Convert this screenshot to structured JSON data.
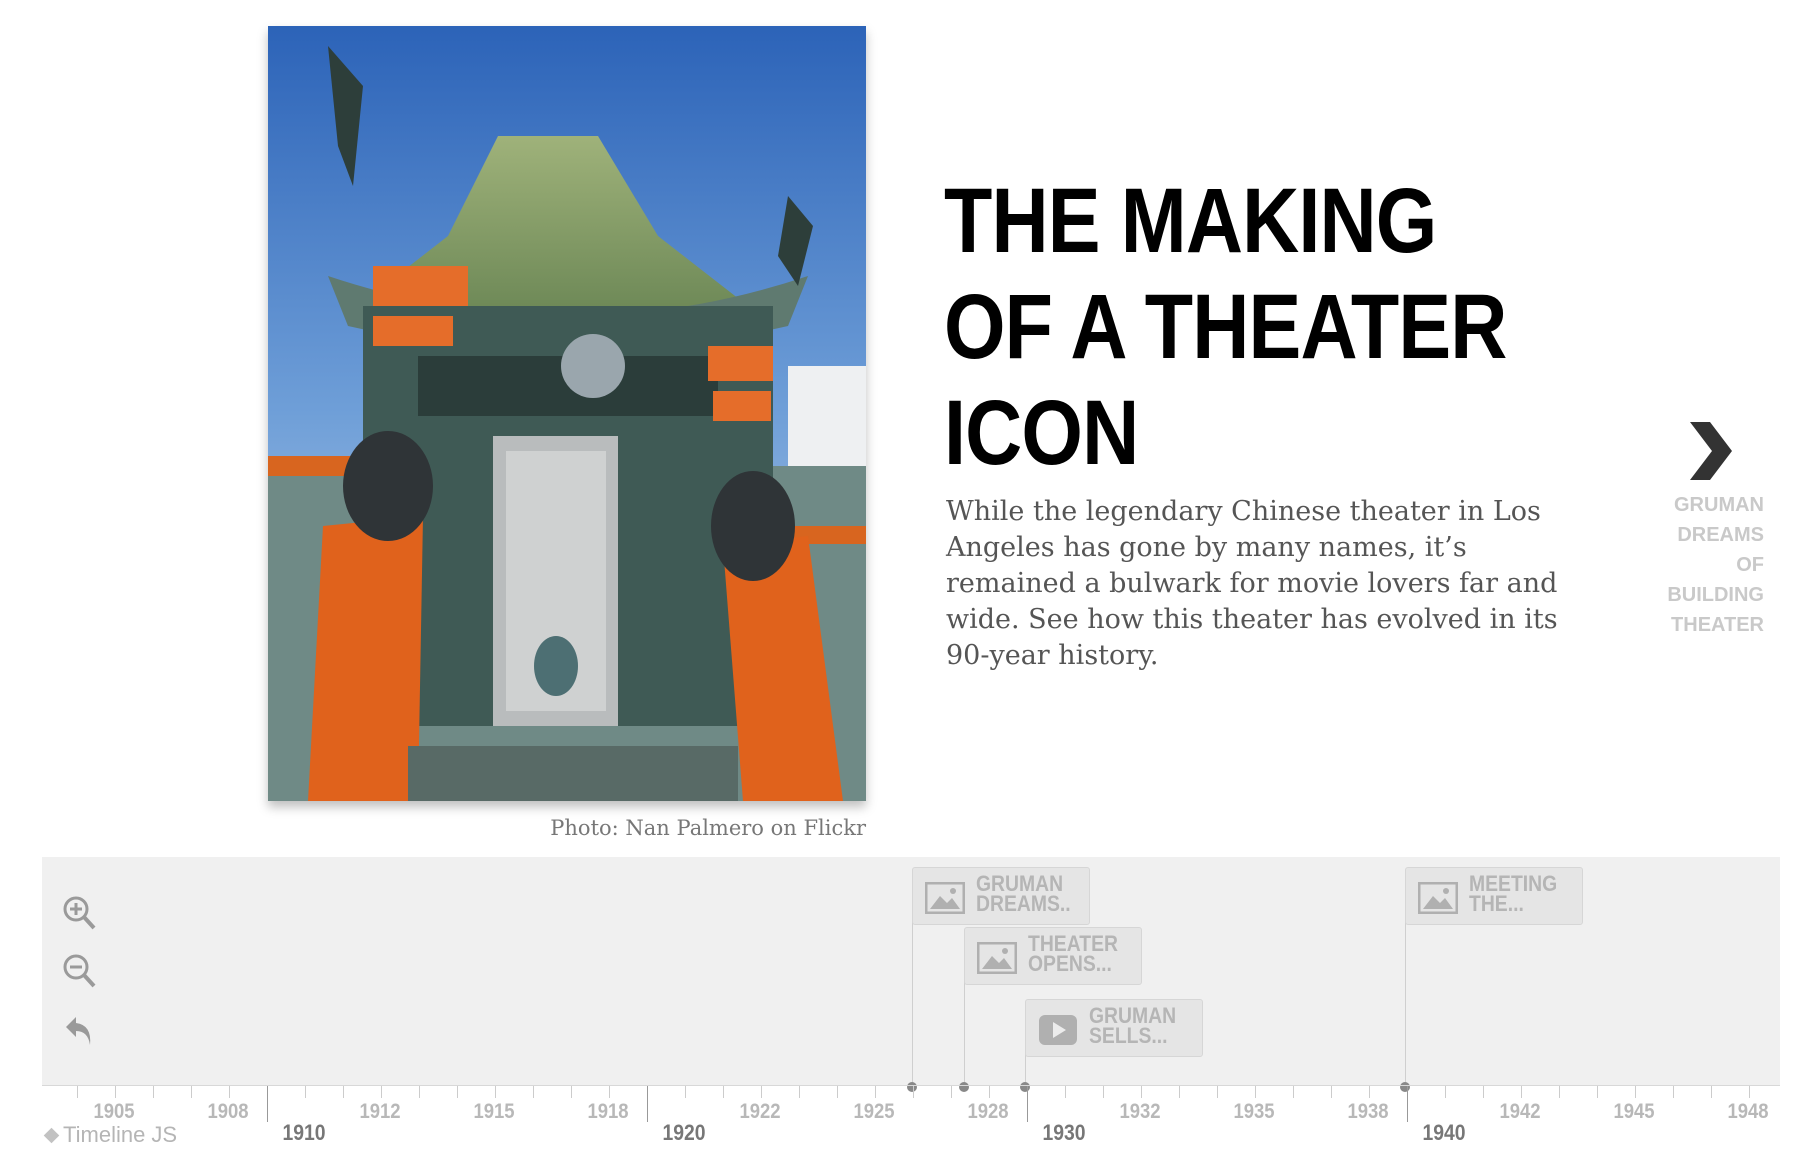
{
  "slide": {
    "headline": "THE MAKING OF A THEATER ICON",
    "text": "While the legendary Chinese theater in Los Angeles has gone by many names, it’s remained a bulwark for movie lovers far and wide. See how this theater has evolved in its 90-year history.",
    "credit": "Photo: Nan Palmero on Flickr",
    "image_subject": "Chinese theater facade with pagoda roof and orange columns"
  },
  "next": {
    "icon": "chevron-right-icon",
    "label": "GRUMAN DREAMS OF BUILDING THEATER"
  },
  "controls": {
    "zoom_in_icon": "zoom-in-icon",
    "zoom_out_icon": "zoom-out-icon",
    "back_icon": "undo-icon"
  },
  "markers": [
    {
      "title": "GRUMAN DREAMS...",
      "media": "image-icon"
    },
    {
      "title": "THEATER OPENS...",
      "media": "image-icon"
    },
    {
      "title": "GRUMAN SELLS...",
      "media": "video-icon"
    },
    {
      "title": "MEETING THE...",
      "media": "image-icon"
    }
  ],
  "axis": {
    "minor": [
      "1905",
      "1908",
      "1912",
      "1915",
      "1918",
      "1922",
      "1925",
      "1928",
      "1932",
      "1935",
      "1938",
      "1942",
      "1945",
      "1948"
    ],
    "major": [
      "1910",
      "1920",
      "1930",
      "1940"
    ]
  },
  "brand": "Timeline JS",
  "colors": {
    "marker_dot": "#888888",
    "panel": "#f0f0f0",
    "muted_text": "#b5b5b5"
  }
}
